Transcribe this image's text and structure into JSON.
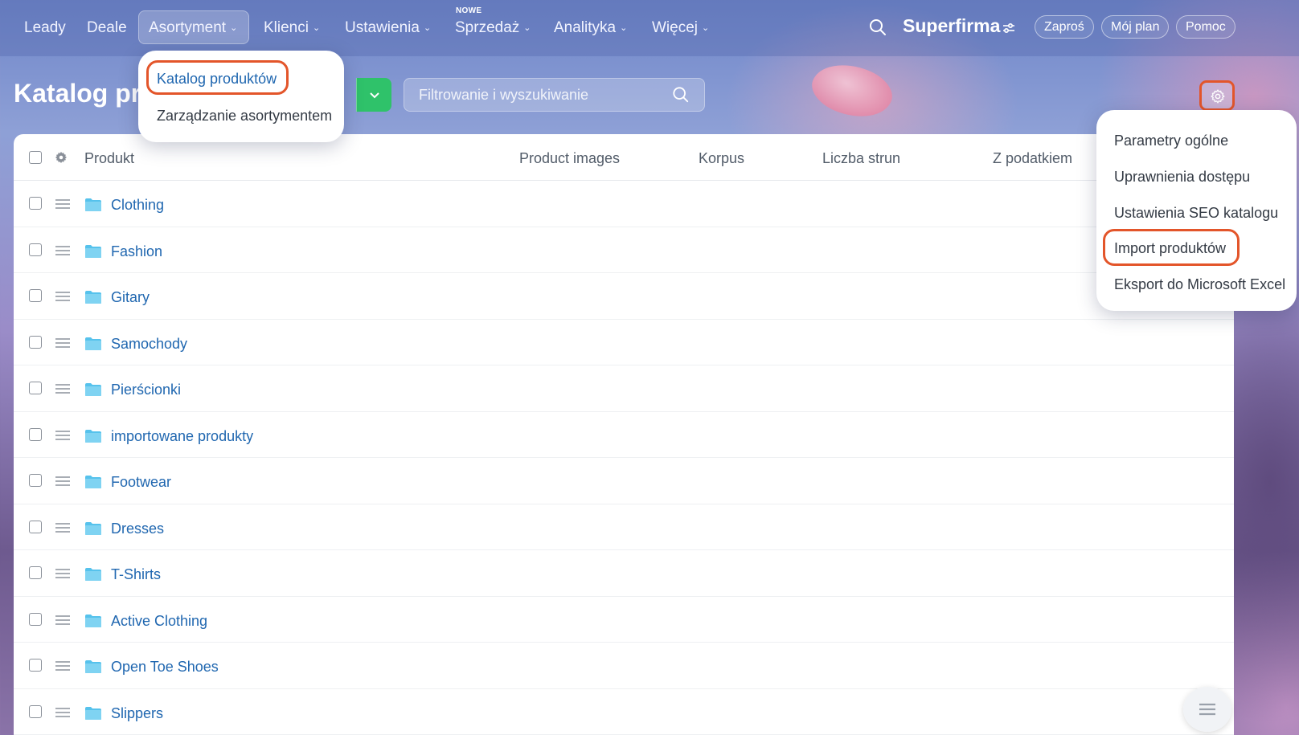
{
  "nav": {
    "items": [
      {
        "label": "Leady",
        "chevron": false
      },
      {
        "label": "Deale",
        "chevron": false
      },
      {
        "label": "Asortyment",
        "chevron": true
      },
      {
        "label": "Klienci",
        "chevron": true
      },
      {
        "label": "Ustawienia",
        "chevron": true
      },
      {
        "label": "Sprzedaż",
        "chevron": true
      },
      {
        "label": "Analityka",
        "chevron": true
      },
      {
        "label": "Więcej",
        "chevron": true
      }
    ],
    "new_badge": "NOWE",
    "brand": "Superfirma",
    "invite": "Zaproś",
    "plan": "Mój plan",
    "help": "Pomoc"
  },
  "header": {
    "title": "Katalog produktów",
    "filter_placeholder": "Filtrowanie i wyszukiwanie"
  },
  "asortyment_menu": {
    "items": [
      "Katalog produktów",
      "Zarządzanie asortymentem"
    ]
  },
  "settings_menu": {
    "items": [
      "Parametry ogólne",
      "Uprawnienia dostępu",
      "Ustawienia SEO katalogu",
      "Import produktów",
      "Eksport do Microsoft Excel"
    ]
  },
  "table": {
    "columns": [
      "Produkt",
      "Product images",
      "Korpus",
      "Liczba strun",
      "Z podatkiem"
    ],
    "rows": [
      "Clothing",
      "Fashion",
      "Gitary",
      "Samochody",
      "Pierścionki",
      "importowane produkty",
      "Footwear",
      "Dresses",
      "T-Shirts",
      "Active Clothing",
      "Open Toe Shoes",
      "Slippers"
    ]
  },
  "colors": {
    "accent_link": "#2067b0",
    "highlight": "#e3552a",
    "add_button": "#2fc26a",
    "folder": "#56c2ec"
  }
}
